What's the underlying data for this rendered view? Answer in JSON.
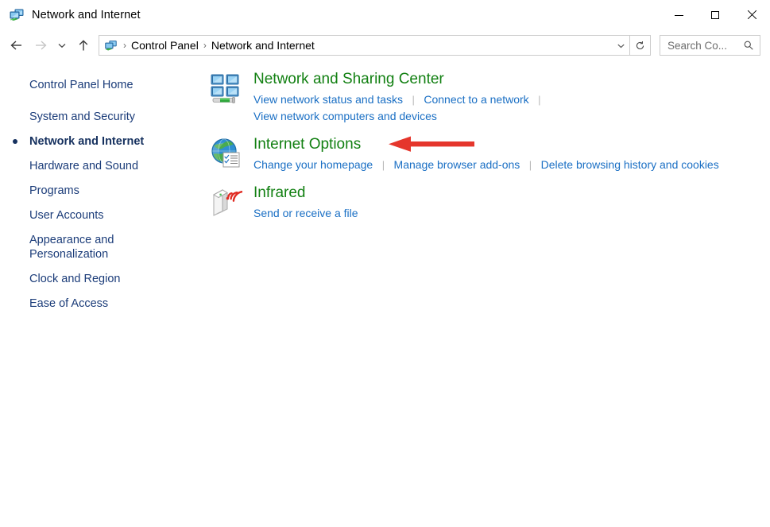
{
  "window": {
    "title": "Network and Internet",
    "icon": "network-monitors-icon",
    "controls": {
      "minimize": "Minimize",
      "maximize": "Maximize",
      "close": "Close"
    }
  },
  "navbar": {
    "back": "Back",
    "forward": "Forward",
    "recent": "Recent locations",
    "up": "Up one level",
    "address_icon": "network-monitors-icon",
    "breadcrumbs": [
      "Control Panel",
      "Network and Internet"
    ],
    "separator": "›",
    "dropdown": "Previous locations",
    "refresh": "Refresh",
    "search": {
      "placeholder": "Search Co...",
      "value": "",
      "icon": "search-icon"
    }
  },
  "sidebar": {
    "items": [
      {
        "label": "Control Panel Home",
        "selected": false
      },
      {
        "label": "System and Security",
        "selected": false
      },
      {
        "label": "Network and Internet",
        "selected": true
      },
      {
        "label": "Hardware and Sound",
        "selected": false
      },
      {
        "label": "Programs",
        "selected": false
      },
      {
        "label": "User Accounts",
        "selected": false
      },
      {
        "label": "Appearance and\nPersonalization",
        "selected": false
      },
      {
        "label": "Clock and Region",
        "selected": false
      },
      {
        "label": "Ease of Access",
        "selected": false
      }
    ]
  },
  "main": {
    "categories": [
      {
        "title": "Network and Sharing Center",
        "icon": "network-sharing-center-icon",
        "links_row1": [
          "View network status and tasks",
          "Connect to a network"
        ],
        "trailing_separator": true,
        "links_row2": [
          "View network computers and devices"
        ]
      },
      {
        "title": "Internet Options",
        "icon": "internet-options-globe-icon",
        "links_row1": [
          "Change your homepage",
          "Manage browser add-ons",
          "Delete browsing history and cookies"
        ],
        "trailing_separator": false,
        "links_row2": []
      },
      {
        "title": "Infrared",
        "icon": "infrared-icon",
        "links_row1": [
          "Send or receive a file"
        ],
        "trailing_separator": false,
        "links_row2": []
      }
    ]
  },
  "annotation": {
    "type": "arrow",
    "direction": "left",
    "target": "Internet Options",
    "color": "#e5362c"
  },
  "colors": {
    "category_title_green": "#128012",
    "link_blue": "#1a6fc4",
    "sidebar_blue": "#1b3c79",
    "annotation_red": "#e5362c"
  }
}
